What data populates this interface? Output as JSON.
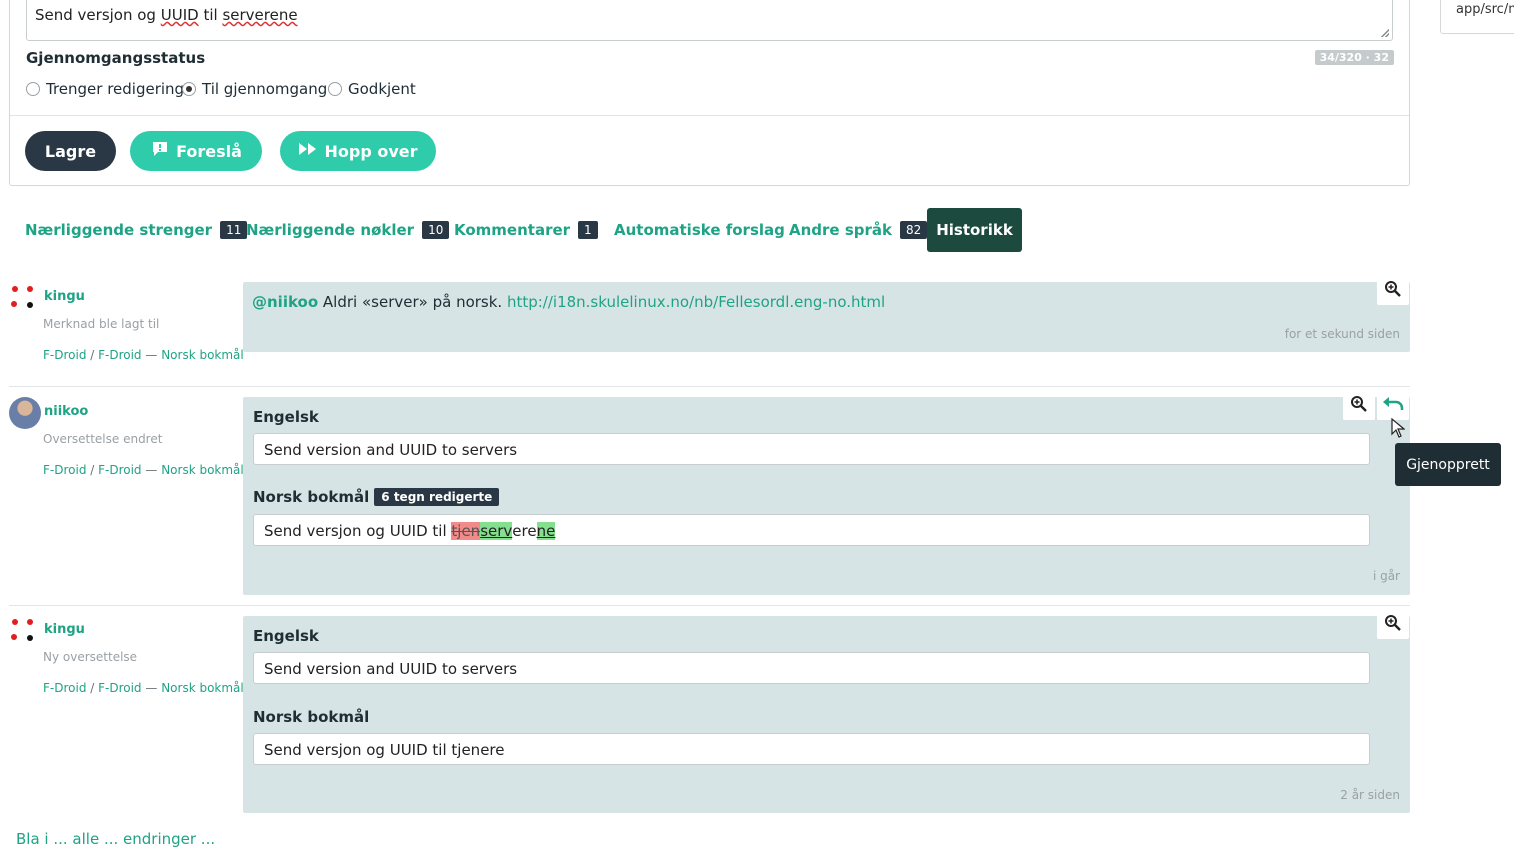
{
  "editor": {
    "translation_text_parts": [
      "Send versjon og ",
      "UUID",
      " til ",
      "serverene"
    ],
    "review_label": "Gjennomgangsstatus",
    "counter": "34/320 · 32",
    "review_options": [
      {
        "label": "Trenger redigering",
        "checked": false
      },
      {
        "label": "Til gjennomgang",
        "checked": true
      },
      {
        "label": "Godkjent",
        "checked": false
      }
    ],
    "buttons": {
      "save": "Lagre",
      "suggest": "Foreslå",
      "skip": "Hopp over"
    }
  },
  "right_panel": {
    "path_text": "app/src/m"
  },
  "tabs": [
    {
      "label": "Nærliggende strenger",
      "count": "11"
    },
    {
      "label": "Nærliggende nøkler",
      "count": "10"
    },
    {
      "label": "Kommentarer",
      "count": "1"
    },
    {
      "label": "Automatiske forslag",
      "count": ""
    },
    {
      "label": "Andre språk",
      "count": "82"
    },
    {
      "label": "Historikk",
      "count": ""
    }
  ],
  "history": {
    "entry1": {
      "user": "kingu",
      "action": "Merknad ble lagt til",
      "project": "F-Droid",
      "component": "F-Droid",
      "language": "Norsk bokmål",
      "mention": "@niikoo",
      "comment": " Aldri «server» på norsk. ",
      "link": "http://i18n.skulelinux.no/nb/Fellesordl.eng-no.html",
      "time": "for et sekund siden"
    },
    "entry2": {
      "user": "niikoo",
      "action": "Oversettelse endret",
      "project": "F-Droid",
      "component": "F-Droid",
      "language": "Norsk bokmål",
      "source_label": "Engelsk",
      "source_text": "Send version and UUID to servers",
      "target_label": "Norsk bokmål",
      "edit_badge": "6 tegn redigerte",
      "diff": {
        "prefix": "Send versjon og UUID til ",
        "del1": "tjen",
        "ins1": "serv",
        "mid": "ere",
        "ins2": "ne"
      },
      "time": "i går",
      "tooltip": "Gjenopprett"
    },
    "entry3": {
      "user": "kingu",
      "action": "Ny oversettelse",
      "project": "F-Droid",
      "component": "F-Droid",
      "language": "Norsk bokmål",
      "source_label": "Engelsk",
      "source_text": "Send version and UUID to servers",
      "target_label": "Norsk bokmål",
      "target_text": "Send versjon og UUID til tjenere",
      "time": "2 år siden"
    }
  },
  "separator": " / ",
  "dash": " — ",
  "bottom_link": "Bla i ... alle ... endringer ..."
}
